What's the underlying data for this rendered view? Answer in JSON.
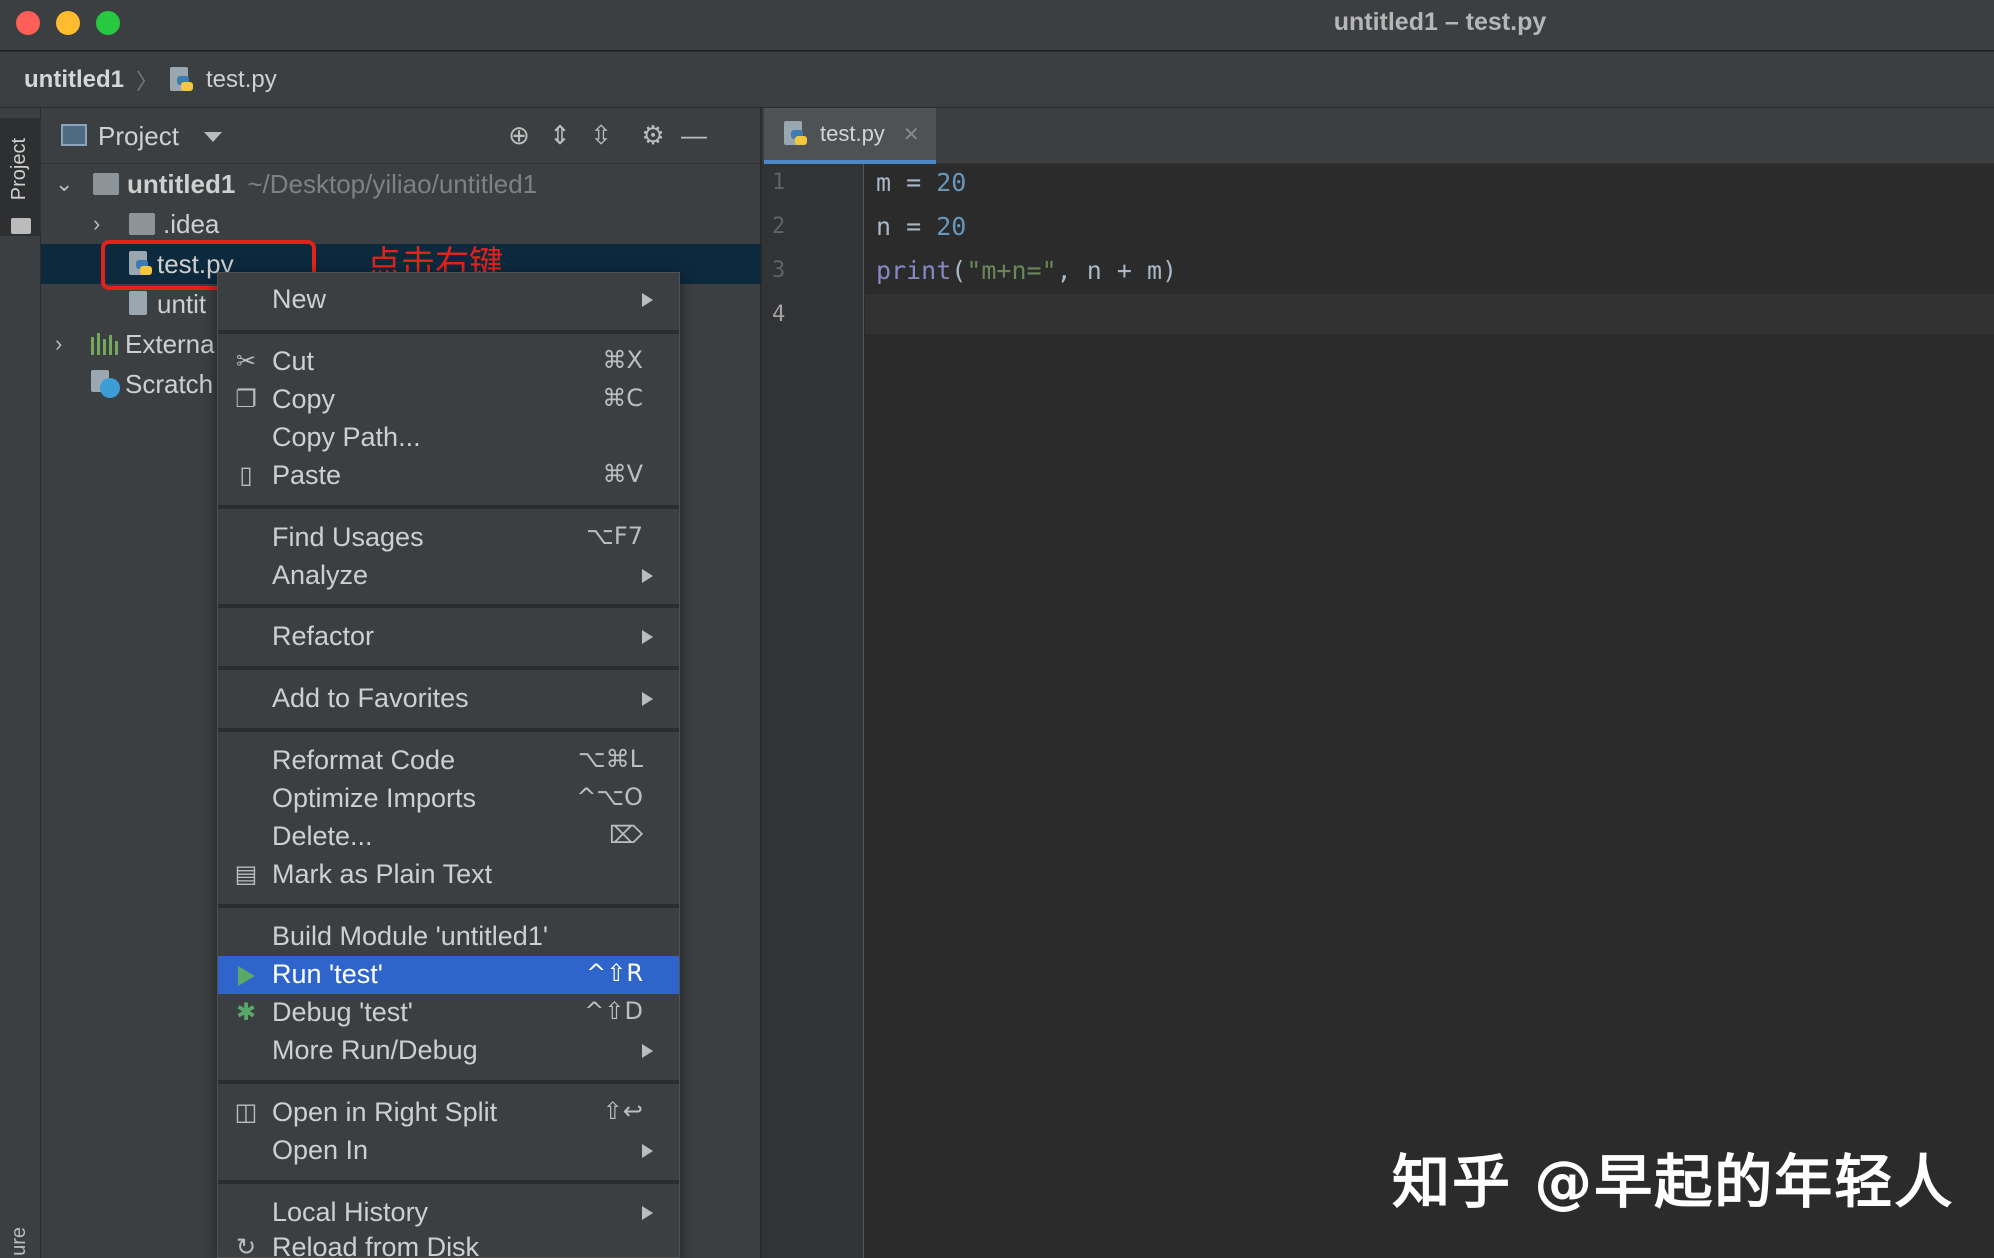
{
  "window": {
    "title": "untitled1 – test.py"
  },
  "breadcrumb": {
    "root": "untitled1",
    "separator": "〉",
    "file": "test.py"
  },
  "tool_stripe": {
    "project_label": "Project",
    "bottom_label": "ure"
  },
  "project_panel": {
    "title": "Project",
    "tree": {
      "root_name": "untitled1",
      "root_path": "~/Desktop/yiliao/untitled1",
      "idea": ".idea",
      "selected_file": "test.py",
      "other_file": "untit",
      "external": "Externa",
      "scratches": "Scratch"
    }
  },
  "annotation": {
    "text": "点击右键",
    "color": "#e3231b"
  },
  "editor": {
    "tab_label": "test.py",
    "line_numbers": [
      "1",
      "2",
      "3",
      "4"
    ],
    "code": {
      "l1_var": "m",
      "l1_op": " = ",
      "l1_num": "20",
      "l2_var": "n",
      "l2_op": " = ",
      "l2_num": "20",
      "l3_fn": "print",
      "l3_open": "(",
      "l3_str": "\"m+n=\"",
      "l3_rest": ", n + m)"
    }
  },
  "context_menu": {
    "new": "New",
    "cut": "Cut",
    "cut_sc": "⌘X",
    "copy": "Copy",
    "copy_sc": "⌘C",
    "copy_path": "Copy Path...",
    "paste": "Paste",
    "paste_sc": "⌘V",
    "find_usages": "Find Usages",
    "find_usages_sc": "⌥F7",
    "analyze": "Analyze",
    "refactor": "Refactor",
    "add_favorites": "Add to Favorites",
    "reformat": "Reformat Code",
    "reformat_sc": "⌥⌘L",
    "optimize": "Optimize Imports",
    "optimize_sc": "^⌥O",
    "delete": "Delete...",
    "delete_sc": "⌦",
    "mark_plain": "Mark as Plain Text",
    "build_module": "Build Module 'untitled1'",
    "run": "Run 'test'",
    "run_sc": "^⇧R",
    "debug": "Debug 'test'",
    "debug_sc": "^⇧D",
    "more_run": "More Run/Debug",
    "open_split": "Open in Right Split",
    "open_split_sc": "⇧↩",
    "open_in": "Open In",
    "local_history": "Local History",
    "reload": "Reload from Disk"
  },
  "watermark": "知乎 @早起的年轻人",
  "colors": {
    "accent": "#2f65ca",
    "selection": "#0d293e",
    "run_green": "#59a869"
  }
}
